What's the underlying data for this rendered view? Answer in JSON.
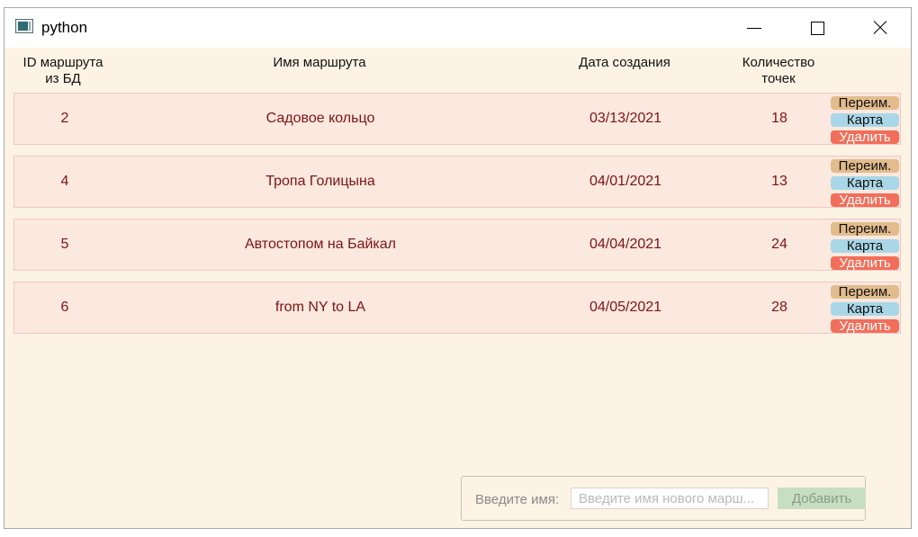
{
  "window": {
    "title": "python"
  },
  "headers": {
    "id_line1": "ID маршрута",
    "id_line2": "из БД",
    "name": "Имя маршрута",
    "date": "Дата создания",
    "count_line1": "Количество",
    "count_line2": "точек"
  },
  "rows": [
    {
      "id": "2",
      "name": "Садовое кольцо",
      "date": "03/13/2021",
      "count": "18"
    },
    {
      "id": "4",
      "name": "Тропа Голицына",
      "date": "04/01/2021",
      "count": "13"
    },
    {
      "id": "5",
      "name": "Автостопом на Байкал",
      "date": "04/04/2021",
      "count": "24"
    },
    {
      "id": "6",
      "name": "from NY to LA",
      "date": "04/05/2021",
      "count": "28"
    }
  ],
  "row_buttons": {
    "rename": "Переим.",
    "map": "Карта",
    "delete": "Удалить"
  },
  "add_form": {
    "label": "Введите имя:",
    "placeholder": "Введите имя нового марш...",
    "button": "Добавить"
  },
  "colors": {
    "background": "#fdf3e4",
    "row_background": "#fbe8df",
    "row_text": "#7d1414",
    "rename_button": "#e2bc8d",
    "map_button": "#a9d7e7",
    "delete_button": "#f16f5a",
    "add_button": "#c6dfc0"
  }
}
